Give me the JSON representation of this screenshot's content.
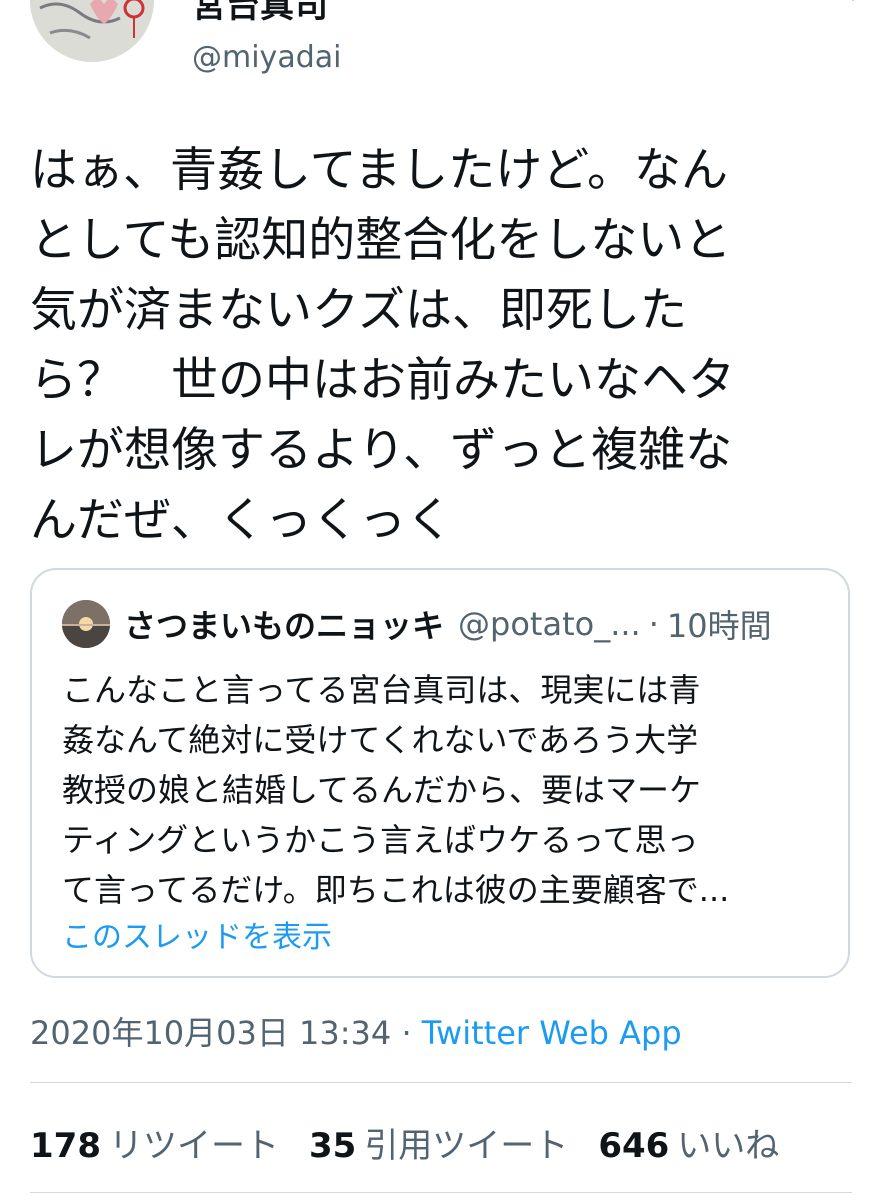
{
  "author": {
    "display_name": "宮台真司",
    "handle": "@miyadai",
    "avatar": "avatar-image"
  },
  "tweet": {
    "lines": [
      "はぁ、青姦してましたけど。なん",
      "としても認知的整合化をしないと",
      "気が済まないクズは、即死した",
      "ら？　世の中はお前みたいなヘタ",
      "レが想像するより、ずっと複雑な",
      "んだぜ、くっくっく"
    ]
  },
  "quote": {
    "display_name": "さつまいものニョッキ",
    "handle": "@potato_...",
    "separator": "·",
    "time": "10時間",
    "lines": [
      "こんなこと言ってる宮台真司は、現実には青",
      "姦なんて絶対に受けてくれないであろう大学",
      "教授の娘と結婚してるんだから、要はマーケ",
      "ティングというかこう言えばウケるって思っ",
      "て言ってるだけ。即ちこれは彼の主要顧客で..."
    ],
    "thread_link": "このスレッドを表示"
  },
  "meta": {
    "timestamp": "2020年10月03日 13:34",
    "separator": " · ",
    "source": "Twitter Web App"
  },
  "stats": {
    "retweets": {
      "count": "178",
      "label": "リツイート"
    },
    "quotes": {
      "count": "35",
      "label": "引用ツイート"
    },
    "likes": {
      "count": "646",
      "label": "いいね"
    }
  },
  "colors": {
    "link": "#1d9bf0",
    "secondary_text": "#536471",
    "border": "#cfd9de"
  }
}
